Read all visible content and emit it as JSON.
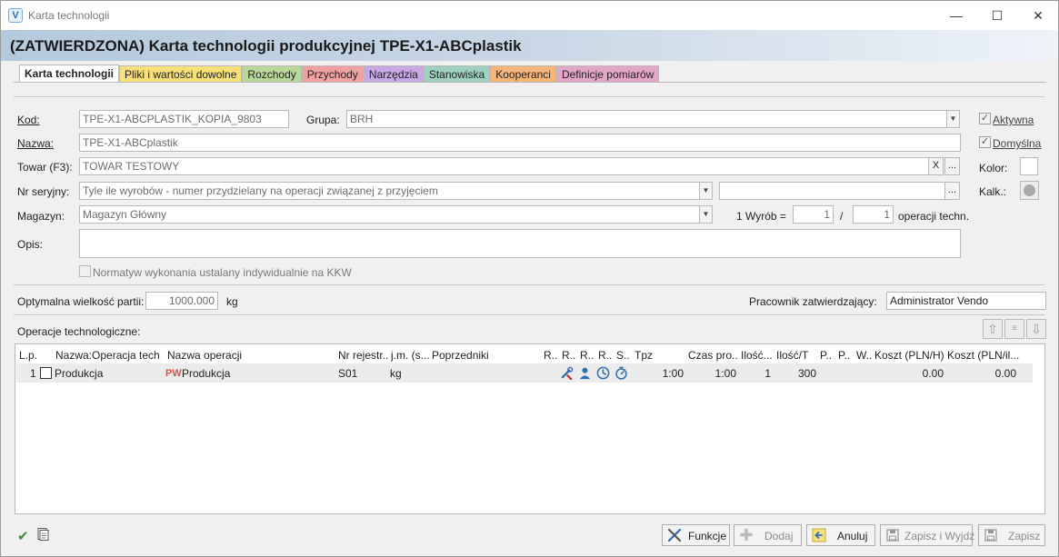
{
  "window": {
    "title": "Karta technologii",
    "app_icon": "V"
  },
  "header": {
    "title": "(ZATWIERDZONA) Karta technologii produkcyjnej TPE-X1-ABCplastik"
  },
  "tabs": [
    {
      "label": "Karta technologii",
      "color": "#ffffff"
    },
    {
      "label": "Pliki i wartości dowolne",
      "color": "#f7e07a"
    },
    {
      "label": "Rozchody",
      "color": "#b9d99a"
    },
    {
      "label": "Przychody",
      "color": "#f2a1a1"
    },
    {
      "label": "Narzędzia",
      "color": "#c8a8e6"
    },
    {
      "label": "Stanowiska",
      "color": "#9fd0c0"
    },
    {
      "label": "Kooperanci",
      "color": "#f7b57a"
    },
    {
      "label": "Definicje pomiarów",
      "color": "#e2a7c6"
    }
  ],
  "form": {
    "kod_label": "Kod:",
    "kod_value": "TPE-X1-ABCPLASTIK_KOPIA_9803",
    "grupa_label": "Grupa:",
    "grupa_value": "BRH",
    "nazwa_label": "Nazwa:",
    "nazwa_value": "TPE-X1-ABCplastik",
    "towar_label": "Towar (F3):",
    "towar_value": "TOWAR TESTOWY",
    "towar_clear": "X",
    "ellipsis": "...",
    "nr_label": "Nr seryjny:",
    "nr_value": "Tyle ile wyrobów - numer przydzielany na operacji związanej z przyjęciem",
    "nr_extra_value": "",
    "magazyn_label": "Magazyn:",
    "magazyn_value": "Magazyn Główny",
    "wyrob_label": "1 Wyrób =",
    "wyrob_value": "1",
    "slash": "/",
    "operacji_value": "1",
    "operacji_label": "operacji techn.",
    "opis_label": "Opis:",
    "opis_value": "",
    "normatyw_label": "Normatyw wykonania ustalany indywidualnie na KKW",
    "aktywna_label": "Aktywna",
    "domyslna_label": "Domyślna",
    "kolor_label": "Kolor:",
    "kalk_label": "Kalk.:",
    "partia_label": "Optymalna wielkość partii:",
    "partia_value": "1000.000",
    "partia_unit": "kg",
    "pracownik_label": "Pracownik zatwierdzający:",
    "pracownik_value": "Administrator Vendo"
  },
  "operations": {
    "label": "Operacje technologiczne:",
    "columns": [
      "L.p.",
      "Nazwa:Operacja tech.",
      "Nazwa operacji",
      "Nr rejestr...",
      "j.m. (s...",
      "Poprzedniki",
      "R..",
      "R..",
      "R..",
      "R..",
      "S..",
      "Tpz",
      "Czas pro...",
      "Ilość...",
      "Ilość/T",
      "P..",
      "P..",
      "W..",
      "Koszt (PLN/H)",
      "Koszt (PLN/il..."
    ],
    "rows": [
      {
        "lp": "1",
        "nazwa_op": "Produkcja",
        "pw_tag": "PW",
        "nazwa": "Produkcja",
        "nr": "S01",
        "jm": "kg",
        "tpz": "1:00",
        "czas": "1:00",
        "ilosc": "1",
        "ilosc_t": "300",
        "koszt_h": "0.00",
        "koszt_il": "0.00"
      }
    ]
  },
  "buttons": {
    "funkcje": "Funkcje",
    "dodaj": "Dodaj",
    "anuluj": "Anuluj",
    "zapisz_wyjdz": "Zapisz i Wyjdź",
    "zapisz": "Zapisz"
  },
  "colors": {
    "accent": "#2d6fb3",
    "header_gradient_start": "#b4c9dd",
    "approve_green": "#3c8c3c"
  }
}
